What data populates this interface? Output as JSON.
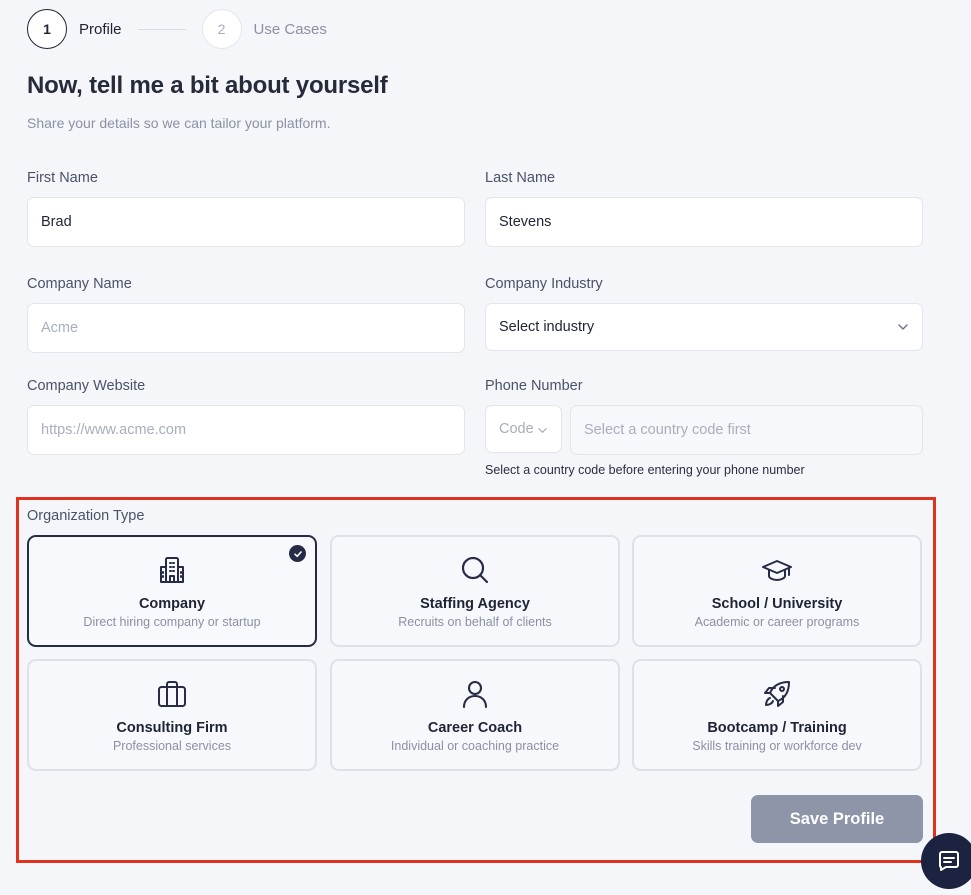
{
  "stepper": {
    "steps": [
      {
        "number": "1",
        "label": "Profile"
      },
      {
        "number": "2",
        "label": "Use Cases"
      }
    ]
  },
  "header": {
    "title": "Now, tell me a bit about yourself",
    "subtitle": "Share your details so we can tailor your platform."
  },
  "form": {
    "first_name": {
      "label": "First Name",
      "value": "Brad"
    },
    "last_name": {
      "label": "Last Name",
      "value": "Stevens"
    },
    "company_name": {
      "label": "Company Name",
      "value": "",
      "placeholder": "Acme"
    },
    "company_industry": {
      "label": "Company Industry",
      "value": "Select industry"
    },
    "company_website": {
      "label": "Company Website",
      "value": "",
      "placeholder": "https://www.acme.com"
    },
    "phone": {
      "label": "Phone Number",
      "code_placeholder": "Code",
      "number_placeholder": "Select a country code first",
      "helper": "Select a country code before entering your phone number"
    }
  },
  "organization": {
    "label": "Organization Type",
    "options": [
      {
        "icon": "building-icon",
        "title": "Company",
        "description": "Direct hiring company or startup",
        "selected": true
      },
      {
        "icon": "search-icon",
        "title": "Staffing Agency",
        "description": "Recruits on behalf of clients",
        "selected": false
      },
      {
        "icon": "graduation-cap-icon",
        "title": "School / University",
        "description": "Academic or career programs",
        "selected": false
      },
      {
        "icon": "briefcase-icon",
        "title": "Consulting Firm",
        "description": "Professional services",
        "selected": false
      },
      {
        "icon": "user-icon",
        "title": "Career Coach",
        "description": "Individual or coaching practice",
        "selected": false
      },
      {
        "icon": "rocket-icon",
        "title": "Bootcamp / Training",
        "description": "Skills training or workforce dev",
        "selected": false
      }
    ]
  },
  "actions": {
    "save_label": "Save Profile"
  },
  "colors": {
    "primary_dark": "#1e2435",
    "selected_border": "#262c46",
    "highlight_frame": "#e0321f",
    "disabled_button": "#8e95a8"
  }
}
